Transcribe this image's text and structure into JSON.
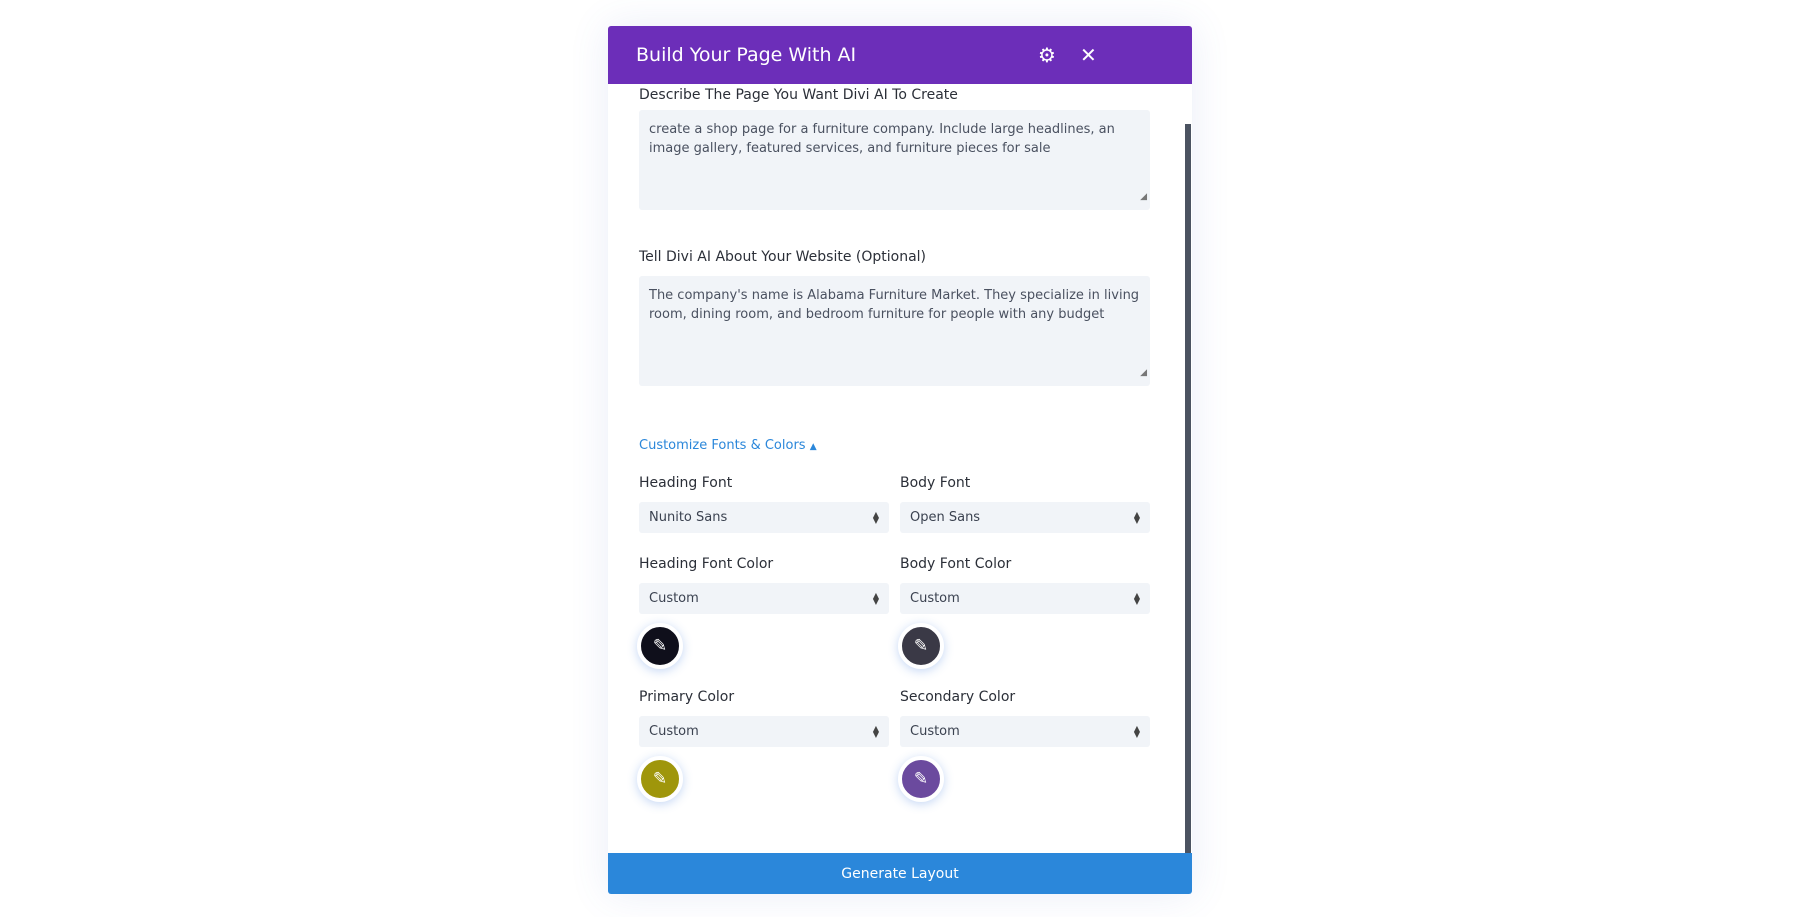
{
  "modal": {
    "title": "Build Your Page With AI",
    "settings_icon": "gear-icon",
    "close_icon": "close-icon"
  },
  "describe": {
    "label": "Describe The Page You Want Divi AI To Create",
    "value": "create a shop page for a furniture company. Include large headlines, an image gallery, featured services, and furniture pieces for sale"
  },
  "website": {
    "label": "Tell Divi AI About Your Website (Optional)",
    "value": "The company's name is Alabama Furniture Market. They specialize in living room, dining room, and bedroom furniture for people with any budget"
  },
  "customize": {
    "label": "Customize Fonts & Colors",
    "arrow": "▲"
  },
  "fields": {
    "heading_font": {
      "label": "Heading Font",
      "value": "Nunito Sans"
    },
    "body_font": {
      "label": "Body Font",
      "value": "Open Sans"
    },
    "heading_color": {
      "label": "Heading Font Color",
      "value": "Custom",
      "swatch": "#0f0f1b"
    },
    "body_color": {
      "label": "Body Font Color",
      "value": "Custom",
      "swatch": "#3a3946"
    },
    "primary_color": {
      "label": "Primary Color",
      "value": "Custom",
      "swatch": "#9f960b"
    },
    "secondary_color": {
      "label": "Secondary Color",
      "value": "Custom",
      "swatch": "#6b4a9e"
    }
  },
  "generate_label": "Generate Layout",
  "colors": {
    "header": "#6c2eb9",
    "button": "#2b87da"
  }
}
